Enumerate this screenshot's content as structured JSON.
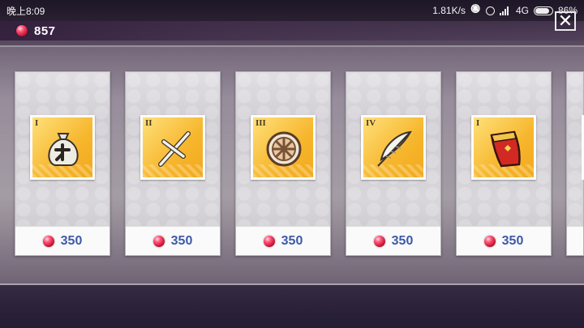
{
  "status_bar": {
    "time": "晚上8:09",
    "network_speed": "1.81K/s",
    "network_type": "4G",
    "battery": "86%"
  },
  "currency": {
    "icon": "red-gem-icon",
    "amount": "857"
  },
  "close": {
    "icon": "close-x-icon"
  },
  "shop": {
    "items": [
      {
        "tier": "I",
        "icon": "money-bag-icon",
        "price": "350"
      },
      {
        "tier": "II",
        "icon": "cross-icon",
        "price": "350"
      },
      {
        "tier": "III",
        "icon": "wheel-icon",
        "price": "350"
      },
      {
        "tier": "IV",
        "icon": "feather-icon",
        "price": "350"
      },
      {
        "tier": "I",
        "icon": "red-cape-icon",
        "price": "350"
      }
    ]
  }
}
